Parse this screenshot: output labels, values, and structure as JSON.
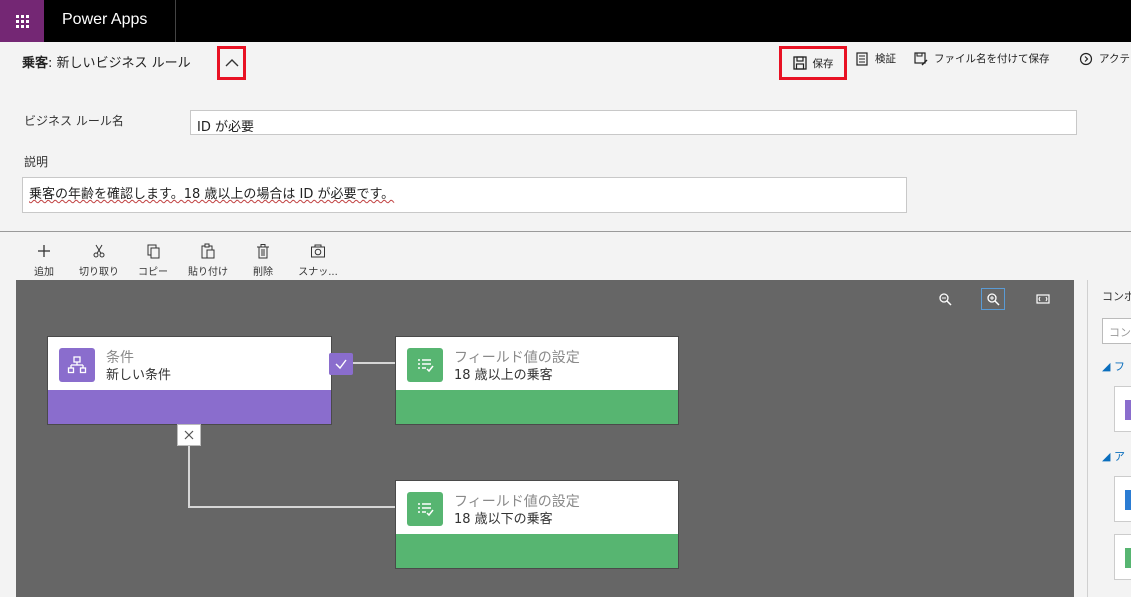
{
  "app": {
    "title": "Power Apps"
  },
  "header": {
    "entity": "乗客",
    "separator": ":",
    "rule_title": "新しいビジネス ルール"
  },
  "commands": {
    "save": "保存",
    "validate": "検証",
    "save_as": "ファイル名を付けて保存",
    "activate": "アクテ"
  },
  "form": {
    "name_label": "ビジネス ルール名",
    "name_value": "ID が必要",
    "desc_label": "説明",
    "desc_value": "乗客の年齢を確認します。18 歳以上の場合は ID が必要です。"
  },
  "toolbar": {
    "add": "追加",
    "cut": "切り取り",
    "copy": "コピー",
    "paste": "貼り付け",
    "delete": "削除",
    "snapshot": "スナッ..."
  },
  "canvas": {
    "condition": {
      "type": "条件",
      "name": "新しい条件",
      "color": "#8a6dcd"
    },
    "action_true": {
      "type": "フィールド値の設定",
      "name": "18 歳以上の乗客",
      "color": "#57b571"
    },
    "action_false": {
      "type": "フィールド値の設定",
      "name": "18 歳以下の乗客",
      "color": "#57b571"
    }
  },
  "right_panel": {
    "tab": "コンポ",
    "search_placeholder": "コン",
    "group1": "フ",
    "group2": "ア"
  },
  "colors": {
    "topbar": "#000000",
    "waffle": "#742774",
    "canvas": "#666666",
    "highlight": "#e81123"
  }
}
